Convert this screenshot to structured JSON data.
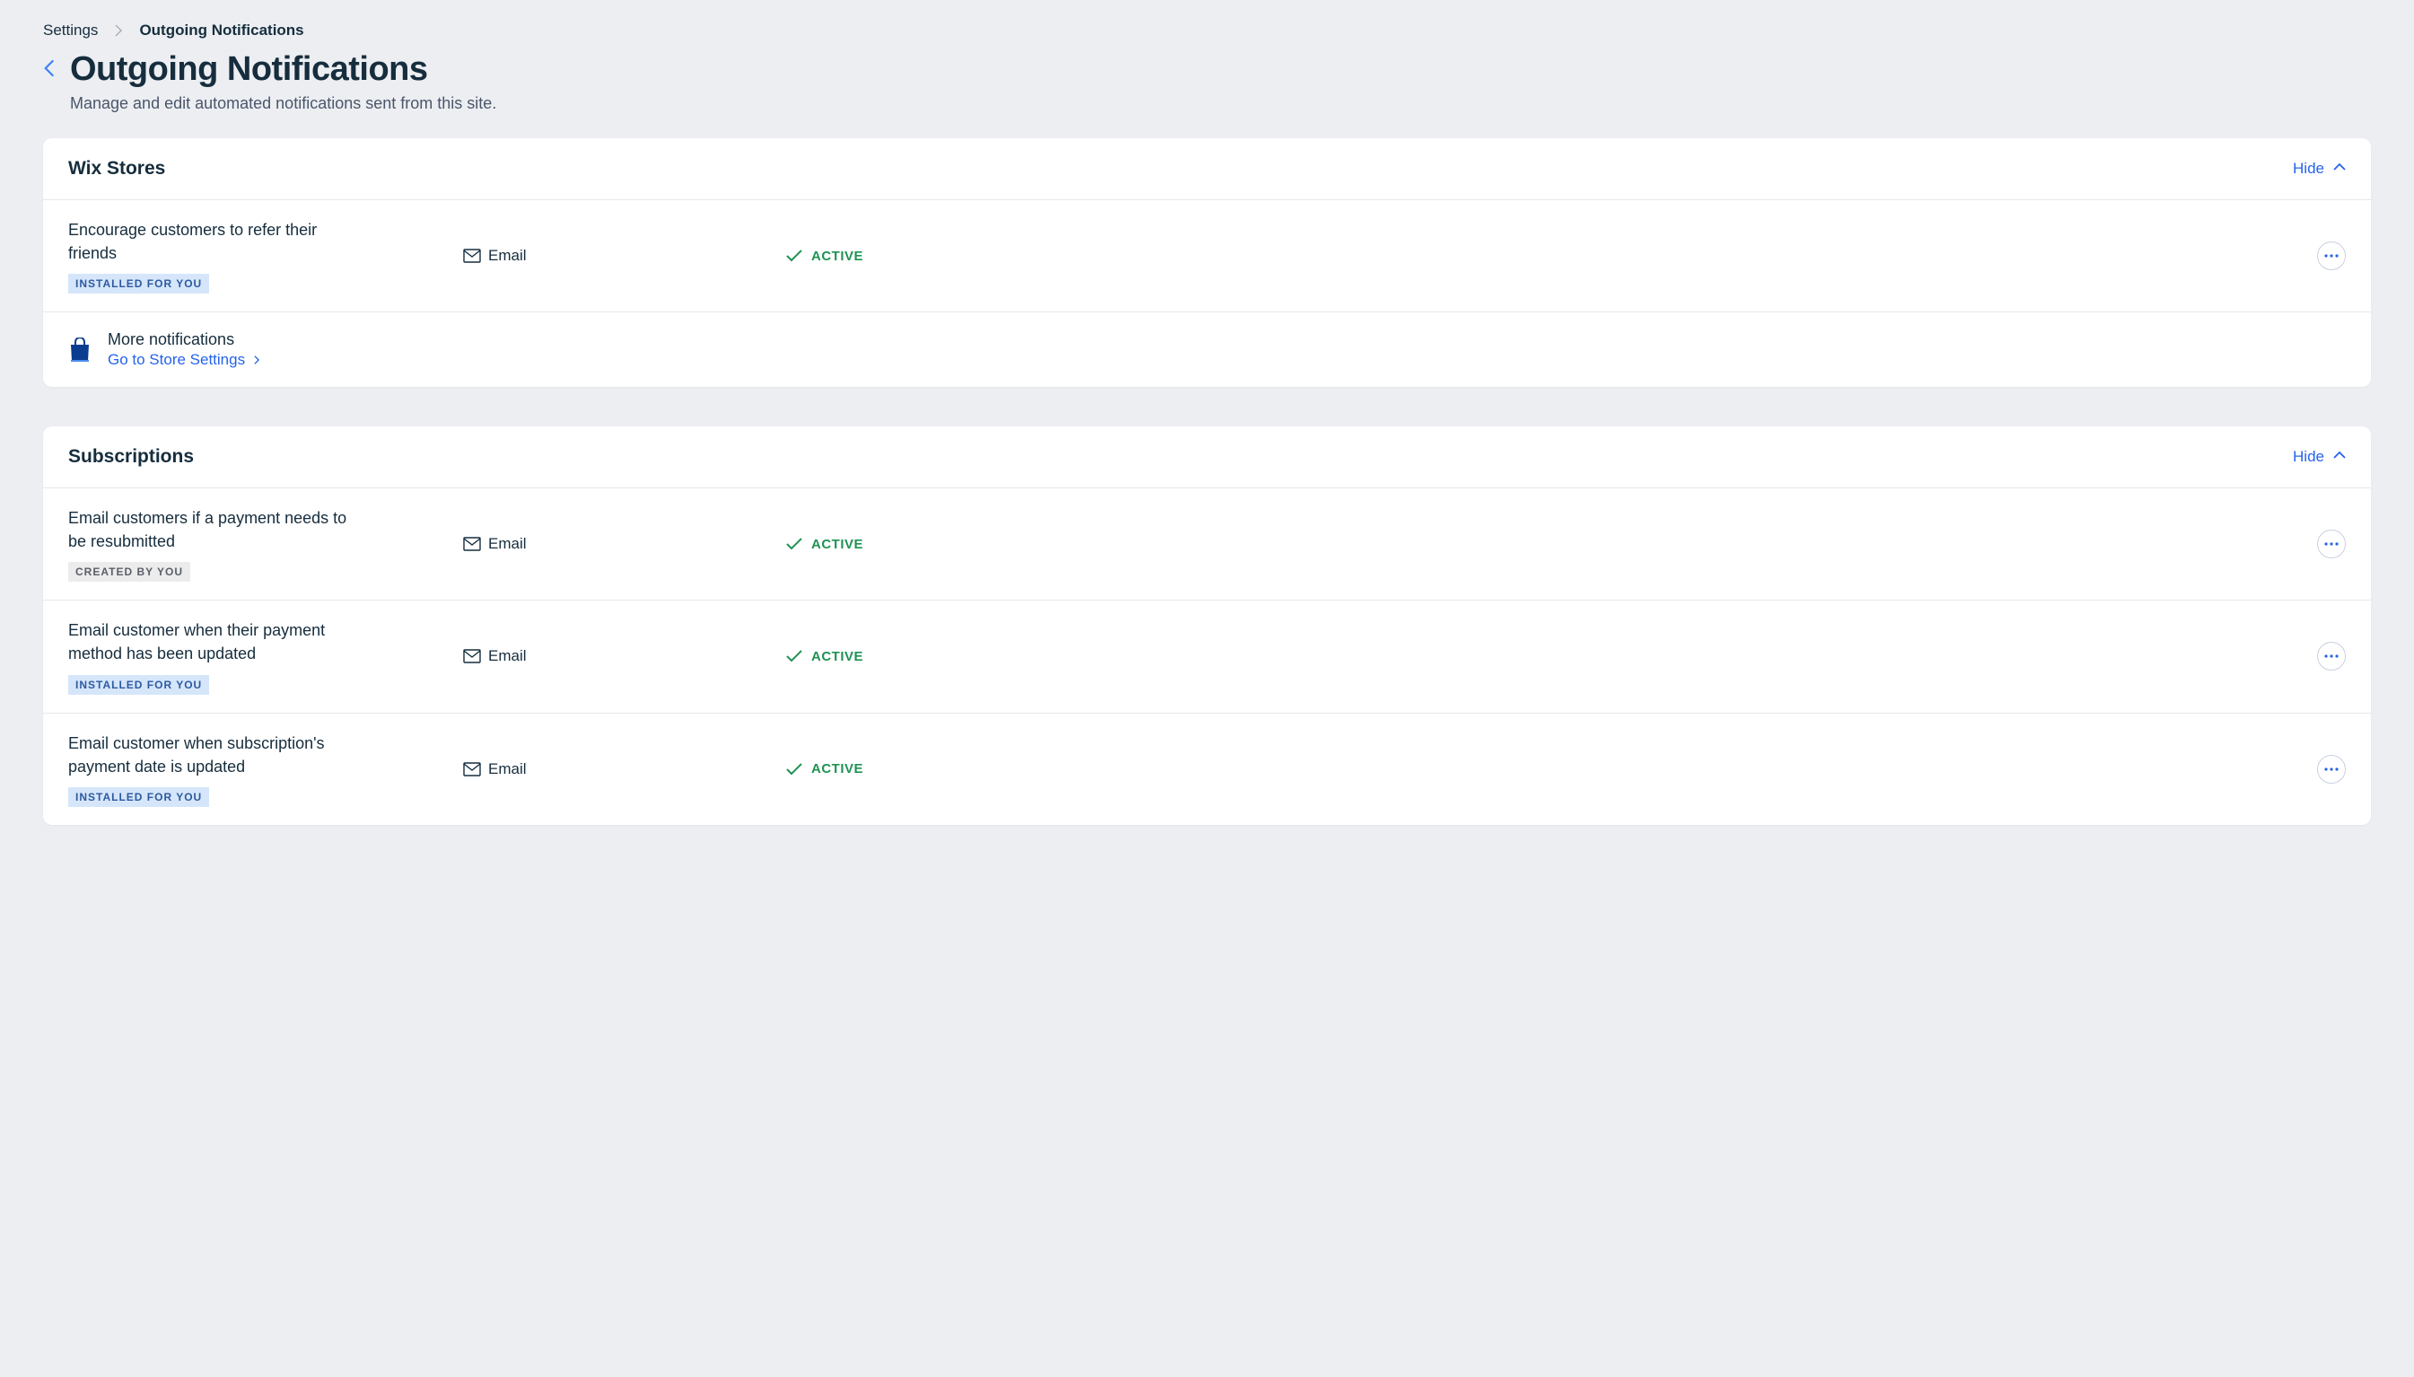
{
  "breadcrumb": {
    "root": "Settings",
    "current": "Outgoing Notifications"
  },
  "page": {
    "title": "Outgoing Notifications",
    "subtitle": "Manage and edit automated notifications sent from this site."
  },
  "labels": {
    "hide": "Hide",
    "email": "Email",
    "active": "ACTIVE",
    "badge_installed": "INSTALLED FOR YOU",
    "badge_created": "CREATED BY YOU"
  },
  "sections": [
    {
      "title": "Wix Stores",
      "rows": [
        {
          "title": "Encourage customers to refer their friends",
          "channel": "Email",
          "status": "ACTIVE",
          "badge_type": "installed"
        }
      ],
      "more": {
        "title": "More notifications",
        "link": "Go to Store Settings"
      }
    },
    {
      "title": "Subscriptions",
      "rows": [
        {
          "title": "Email customers if a payment needs to be resubmitted",
          "channel": "Email",
          "status": "ACTIVE",
          "badge_type": "created"
        },
        {
          "title": "Email customer when their payment method has been updated",
          "channel": "Email",
          "status": "ACTIVE",
          "badge_type": "installed"
        },
        {
          "title": "Email customer when subscription's payment date is updated",
          "channel": "Email",
          "status": "ACTIVE",
          "badge_type": "installed"
        }
      ]
    }
  ]
}
